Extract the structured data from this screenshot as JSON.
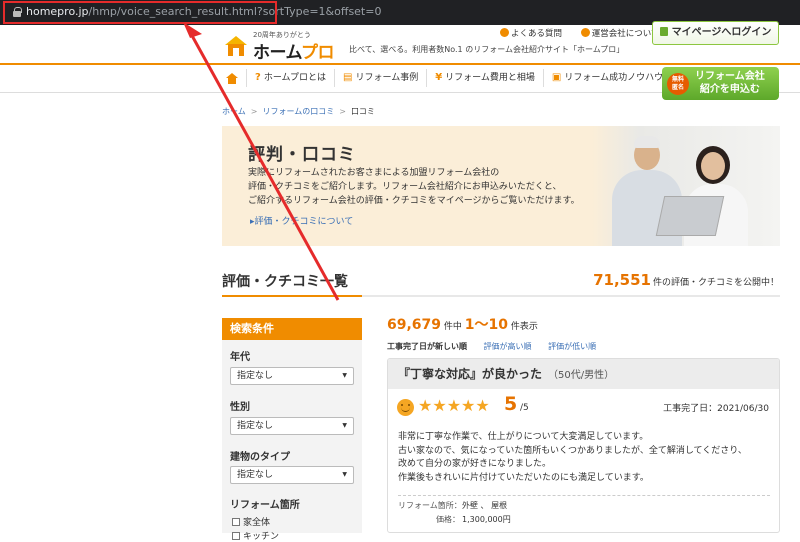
{
  "browser": {
    "url_host": "homepro.jp",
    "url_path": "/hmp/voice_search_result.html?sortType=1&offset=0"
  },
  "header": {
    "logo_tag": "20周年ありがとう",
    "logo_name_pre": "ホーム",
    "logo_name_accent": "プロ",
    "tagline": "比べて、選べる。利用者数No.1 のリフォーム会社紹介サイト「ホームプロ」",
    "faq": "よくある質問",
    "company": "運営会社について",
    "mypage": "マイページへログイン"
  },
  "nav": {
    "items": [
      "ホームプロとは",
      "リフォーム事例",
      "リフォーム費用と相場",
      "リフォーム成功ノウハウ"
    ],
    "glyphs": [
      "?",
      "▤",
      "¥",
      "▣"
    ],
    "cta_badge_1": "無料",
    "cta_badge_2": "匿名",
    "cta_line1": "リフォーム会社",
    "cta_line2": "紹介を申込む"
  },
  "breadcrumb": [
    "ホーム",
    "リフォームの口コミ",
    "口コミ"
  ],
  "hero": {
    "title": "評判・口コミ",
    "desc": "実際にリフォームされたお客さまによる加盟リフォーム会社の\n評価・クチコミをご紹介します。リフォーム会社紹介にお申込みいただくと、\nご紹介するリフォーム会社の評価・クチコミをマイページからご覧いただけます。",
    "link": "評価・クチコミについて"
  },
  "section": {
    "title": "評価・クチコミ一覧",
    "total_num": "71,551",
    "total_suffix": "件の評価・クチコミを公開中！"
  },
  "sidebar": {
    "head": "検索条件",
    "age_label": "年代",
    "age_value": "指定なし",
    "gender_label": "性別",
    "gender_value": "指定なし",
    "building_label": "建物のタイプ",
    "building_value": "指定なし",
    "place_label": "リフォーム箇所",
    "place_opt1": "家全体",
    "place_opt2": "キッチン"
  },
  "results": {
    "count": "69,679",
    "count_suffix": "件中",
    "range": "1〜10",
    "range_suffix": "件表示",
    "sort_options": [
      "工事完了日が新しい順",
      "評価が高い順",
      "評価が低い順"
    ]
  },
  "review": {
    "title": "『丁寧な対応』が良かった",
    "author": "（50代/男性）",
    "stars": "★★★★★",
    "rating": 5,
    "score": "5",
    "out_of": "/5",
    "completed": "工事完了日：2021/06/30",
    "body": "非常に丁寧な作業で、仕上がりについて大変満足しています。\n古い家なので、気になっていた箇所もいくつかありましたが、全て解消してくださり、\n改めて自分の家が好きになりました。\n作業後もきれいに片付けていただいたのにも満足しています。",
    "place_key": "リフォーム箇所：",
    "place_val": "外壁 、 屋根",
    "price_key": "価格：",
    "price_val": "1,300,000円"
  },
  "colors": {
    "accent": "#f08c00",
    "price": "#e67300",
    "link": "#3a6fb5",
    "cta": "#5da82a",
    "annotation": "#e52b2b"
  }
}
